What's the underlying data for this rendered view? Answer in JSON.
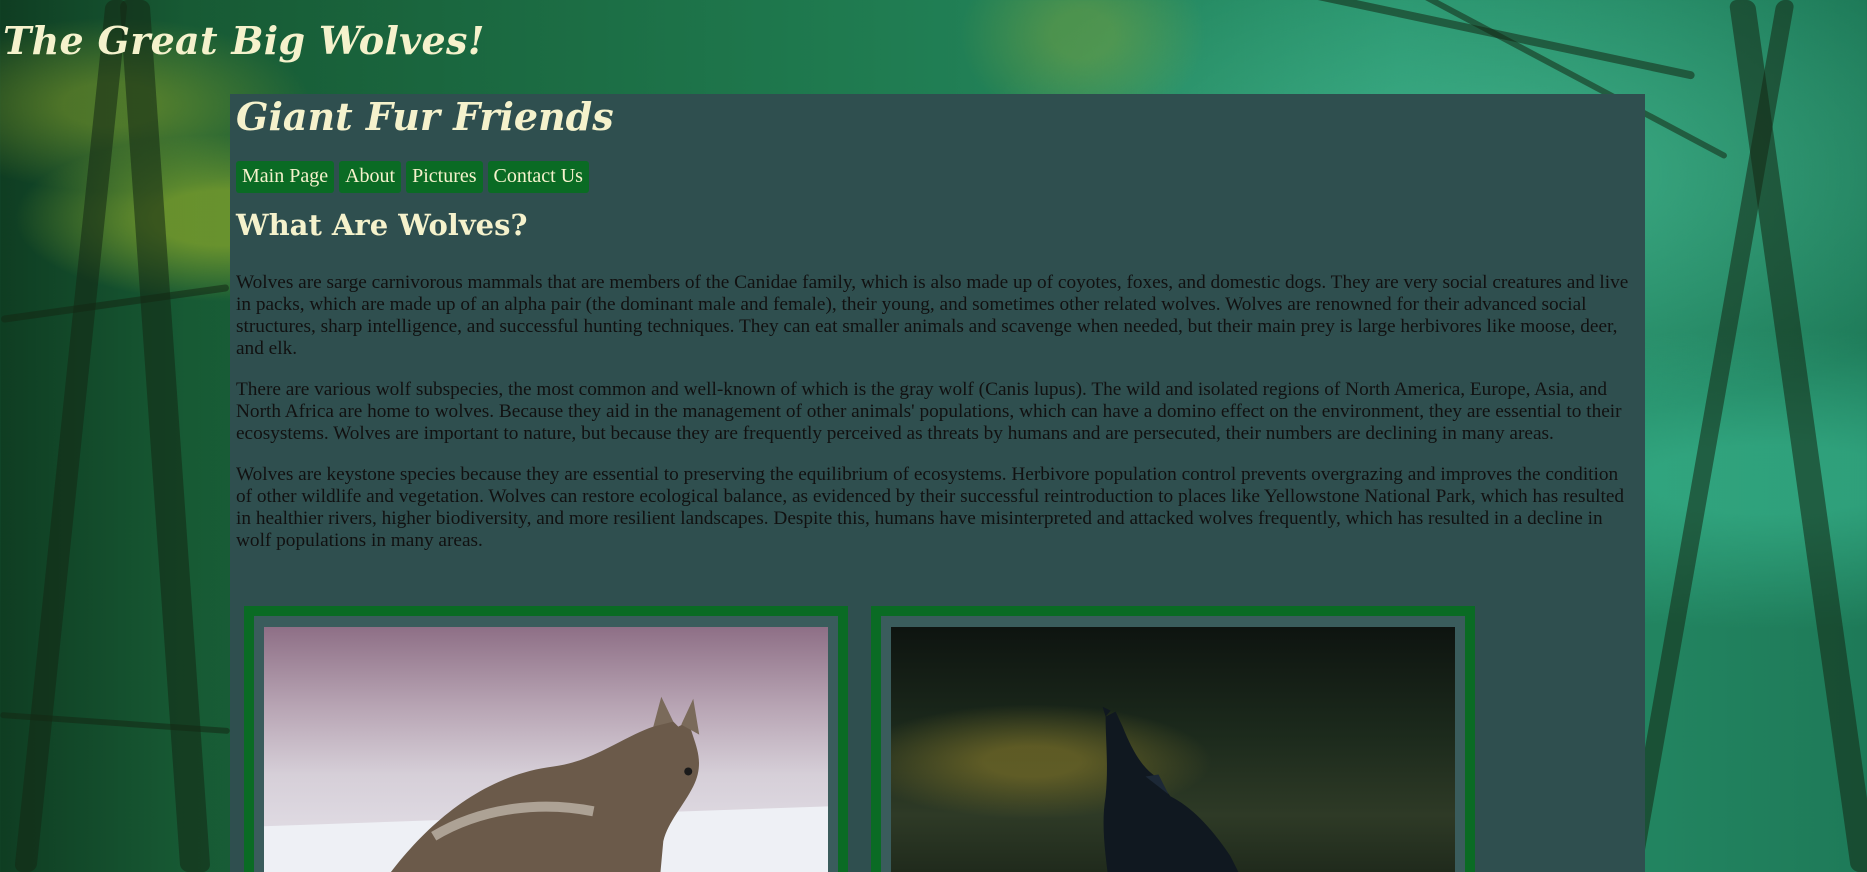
{
  "site": {
    "title": "The Great Big Wolves!"
  },
  "panel": {
    "title": "Giant Fur Friends"
  },
  "nav": {
    "items": [
      {
        "label": "Main Page"
      },
      {
        "label": "About"
      },
      {
        "label": "Pictures"
      },
      {
        "label": "Contact Us"
      }
    ]
  },
  "main": {
    "heading": "What Are Wolves?",
    "paragraphs": [
      "Wolves are sarge carnivorous mammals that are members of the Canidae family, which is also made up of coyotes, foxes, and domestic dogs. They are very social creatures and live in packs, which are made up of an alpha pair (the dominant male and female), their young, and sometimes other related wolves. Wolves are renowned for their advanced social structures, sharp intelligence, and successful hunting techniques. They can eat smaller animals and scavenge when needed, but their main prey is large herbivores like moose, deer, and elk.",
      "There are various wolf subspecies, the most common and well-known of which is the gray wolf (Canis lupus). The wild and isolated regions of North America, Europe, Asia, and North Africa are home to wolves. Because they aid in the management of other animals' populations, which can have a domino effect on the environment, they are essential to their ecosystems. Wolves are important to nature, but because they are frequently perceived as threats by humans and are persecuted, their numbers are declining in many areas.",
      "Wolves are keystone species because they are essential to preserving the equilibrium of ecosystems. Herbivore population control prevents overgrazing and improves the condition of other wildlife and vegetation. Wolves can restore ecological balance, as evidenced by their successful reintroduction to places like Yellowstone National Park, which has resulted in healthier rivers, higher biodiversity, and more resilient landscapes. Despite this, humans have misinterpreted and attacked wolves frequently, which has resulted in a decline in wolf populations in many areas."
    ]
  },
  "colors": {
    "panel_bg": "#2f4f4f",
    "nav_bg": "#0a6b24",
    "heading_text": "#f5f2cc",
    "frame": "#0a6b24"
  },
  "images": [
    {
      "icon": "gray-wolf-in-snow-photo"
    },
    {
      "icon": "howling-wolf-photo"
    }
  ]
}
